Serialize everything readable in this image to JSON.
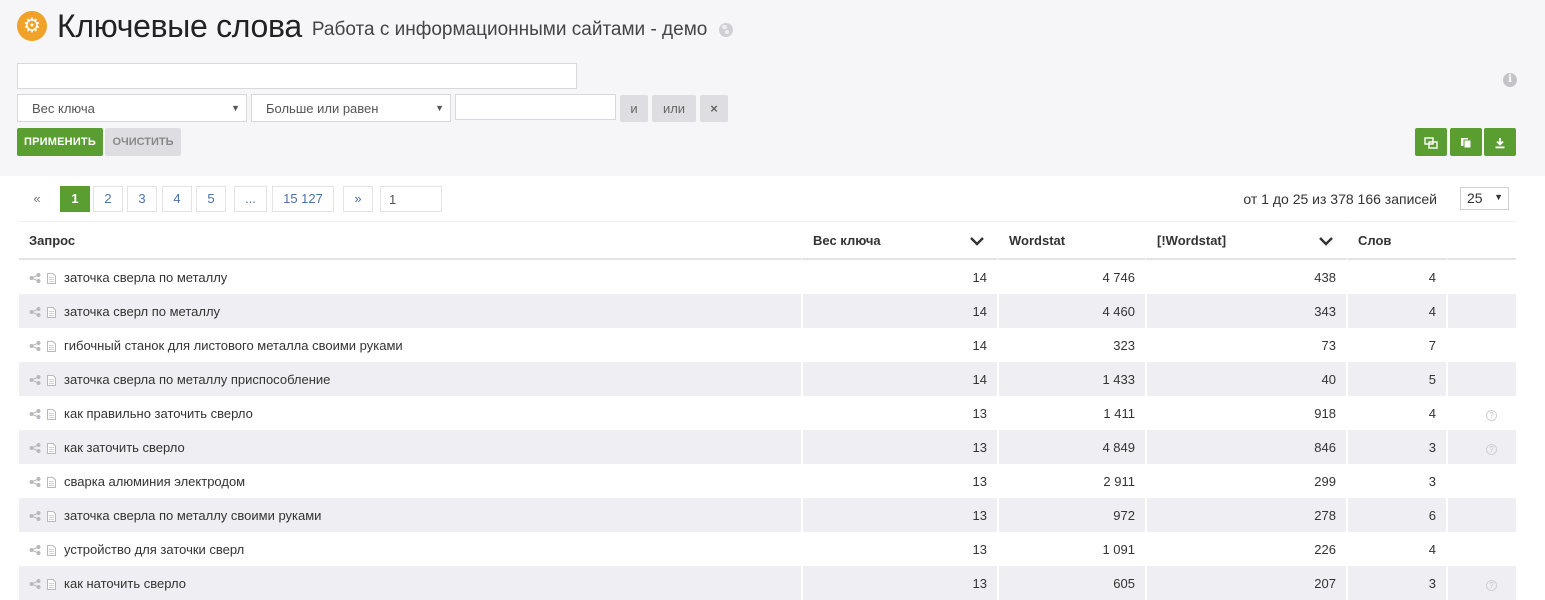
{
  "header": {
    "title": "Ключевые слова",
    "project": "Работа с информационными сайтами - демо",
    "gear_glyph": "⚙"
  },
  "filter": {
    "search_value": "",
    "field_select": "Вес ключа",
    "operator_select": "Больше или равен",
    "value": "",
    "and_label": "и",
    "or_label": "или",
    "remove_label": "×",
    "apply_label": "ПРИМЕНИТЬ",
    "clear_label": "ОЧИСТИТЬ",
    "info_glyph": "i"
  },
  "toolbar": {
    "icons": [
      "columns-icon",
      "copy-icon",
      "download-icon"
    ],
    "accent": "#5a9e31"
  },
  "pagination": {
    "prev": "«",
    "pages": [
      "1",
      "2",
      "3",
      "4",
      "5",
      "...",
      "15 127"
    ],
    "next": "»",
    "goto_value": "1",
    "records_info": "от 1 до 25 из 378 166 записей",
    "page_size": "25"
  },
  "table": {
    "columns": [
      "Запрос",
      "Вес ключа",
      "Wordstat",
      "[!Wordstat]",
      "Слов",
      ""
    ],
    "sort_glyph": "⌄",
    "help_glyph": "?",
    "rows": [
      {
        "query": "заточка сверла по металлу",
        "weight": "14",
        "wordstat": "4 746",
        "exact": "438",
        "words": "4",
        "help": false
      },
      {
        "query": "заточка сверл по металлу",
        "weight": "14",
        "wordstat": "4 460",
        "exact": "343",
        "words": "4",
        "help": false
      },
      {
        "query": "гибочный станок для листового металла своими руками",
        "weight": "14",
        "wordstat": "323",
        "exact": "73",
        "words": "7",
        "help": false
      },
      {
        "query": "заточка сверла по металлу приспособление",
        "weight": "14",
        "wordstat": "1 433",
        "exact": "40",
        "words": "5",
        "help": false
      },
      {
        "query": "как правильно заточить сверло",
        "weight": "13",
        "wordstat": "1 411",
        "exact": "918",
        "words": "4",
        "help": true
      },
      {
        "query": "как заточить сверло",
        "weight": "13",
        "wordstat": "4 849",
        "exact": "846",
        "words": "3",
        "help": true
      },
      {
        "query": "сварка алюминия электродом",
        "weight": "13",
        "wordstat": "2 911",
        "exact": "299",
        "words": "3",
        "help": false
      },
      {
        "query": "заточка сверла по металлу своими руками",
        "weight": "13",
        "wordstat": "972",
        "exact": "278",
        "words": "6",
        "help": false
      },
      {
        "query": "устройство для заточки сверл",
        "weight": "13",
        "wordstat": "1 091",
        "exact": "226",
        "words": "4",
        "help": false
      },
      {
        "query": "как наточить сверло",
        "weight": "13",
        "wordstat": "605",
        "exact": "207",
        "words": "3",
        "help": true
      }
    ]
  }
}
